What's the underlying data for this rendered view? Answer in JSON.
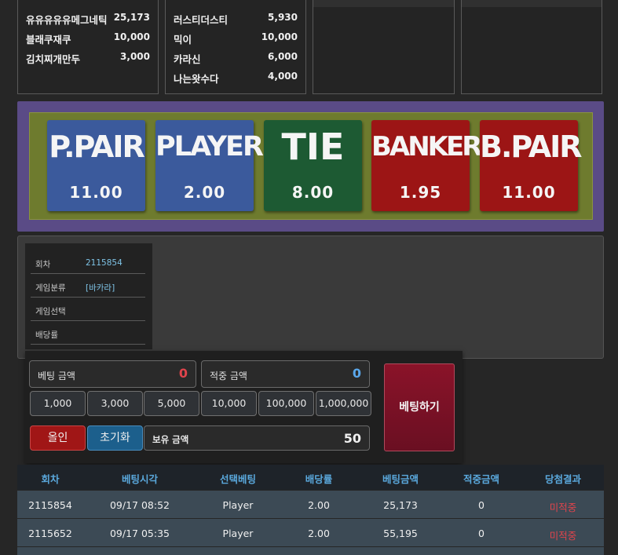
{
  "rankings": {
    "panel1": [
      {
        "name": "유유유유유메그네틱",
        "amount": "25,173"
      },
      {
        "name": "블래쿠재쿠",
        "amount": "10,000"
      },
      {
        "name": "김치찌개만두",
        "amount": "3,000"
      }
    ],
    "panel2": [
      {
        "name": "러스티더스티",
        "amount": "5,930"
      },
      {
        "name": "믹이",
        "amount": "10,000"
      },
      {
        "name": "카라신",
        "amount": "6,000"
      },
      {
        "name": "나는왓수다",
        "amount": "4,000"
      }
    ]
  },
  "bet_options": [
    {
      "name": "P.PAIR",
      "odds": "11.00",
      "color": "#3b5a9c"
    },
    {
      "name": "PLAYER",
      "odds": "2.00",
      "color": "#3b5a9c"
    },
    {
      "name": "TIE",
      "odds": "8.00",
      "color": "#1d5a33"
    },
    {
      "name": "BANKER",
      "odds": "1.95",
      "color": "#9c1515"
    },
    {
      "name": "B.PAIR",
      "odds": "11.00",
      "color": "#9c1515"
    }
  ],
  "info": {
    "round_label": "회차",
    "round_value": "2115854",
    "category_label": "게임분류",
    "category_value": "[바카라]",
    "selection_label": "게임선택",
    "selection_value": "",
    "odds_label": "배당률",
    "odds_value": ""
  },
  "betting": {
    "bet_amount_label": "베팅 금액",
    "bet_amount_value": "0",
    "bet_amount_color": "#e0444c",
    "win_amount_label": "적중 금액",
    "win_amount_value": "0",
    "win_amount_color": "#5aa8ec",
    "chips": [
      "1,000",
      "3,000",
      "5,000",
      "10,000",
      "100,000",
      "1,000,000"
    ],
    "all_in_label": "올인",
    "all_in_color": "#a01616",
    "reset_label": "초기화",
    "reset_color": "#1c5f8c",
    "holding_label": "보유 금액",
    "holding_value": "50",
    "submit_label": "베팅하기"
  },
  "history": {
    "headers": [
      "회차",
      "베팅시각",
      "선택베팅",
      "배당률",
      "베팅금액",
      "적중금액",
      "당첨결과"
    ],
    "rows": [
      [
        "2115854",
        "09/17 08:52",
        "Player",
        "2.00",
        "25,173",
        "0",
        "미적중"
      ],
      [
        "2115652",
        "09/17 05:35",
        "Player",
        "2.00",
        "55,195",
        "0",
        "미적중"
      ]
    ]
  }
}
